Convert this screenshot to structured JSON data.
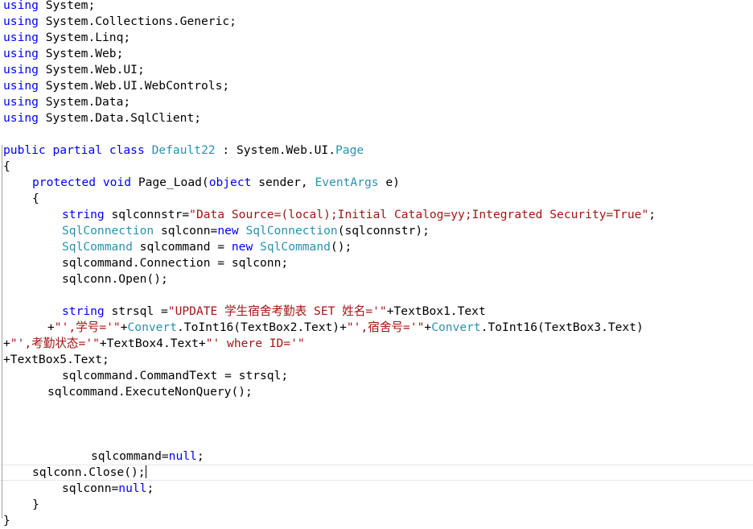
{
  "colors": {
    "keyword": "#0000ff",
    "type": "#2b91af",
    "string": "#a31515",
    "text": "#000000"
  },
  "code": {
    "usings": [
      {
        "kw": "using",
        "ns": " System;"
      },
      {
        "kw": "using",
        "ns": " System.Collections.Generic;"
      },
      {
        "kw": "using",
        "ns": " System.Linq;"
      },
      {
        "kw": "using",
        "ns": " System.Web;"
      },
      {
        "kw": "using",
        "ns": " System.Web.UI;"
      },
      {
        "kw": "using",
        "ns": " System.Web.UI.WebControls;"
      },
      {
        "kw": "using",
        "ns": " System.Data;"
      },
      {
        "kw": "using",
        "ns": " System.Data.SqlClient;"
      }
    ],
    "class_decl": {
      "kw1": "public",
      "kw2": "partial",
      "kw3": "class",
      "name": "Default22",
      "sep": " : System.Web.UI.",
      "base": "Page"
    },
    "open_brace": "{",
    "method_decl": {
      "kw1": "protected",
      "kw2": "void",
      "name": " Page_Load(",
      "ptype1": "object",
      "p1": " sender, ",
      "ptype2": "EventArgs",
      "p2": " e)"
    },
    "method_open": "{",
    "connstr_line": {
      "kw": "string",
      "name": " sqlconnstr=",
      "value": "\"Data Source=(local);Initial Catalog=yy;Integrated Security=True\"",
      "end": ";"
    },
    "conn_line": {
      "type1": "SqlConnection",
      "mid": " sqlconn=",
      "kw": "new",
      "type2": "SqlConnection",
      "end": "(sqlconnstr);"
    },
    "cmd_line": {
      "type1": "SqlCommand",
      "mid": " sqlcommand = ",
      "kw": "new",
      "type2": "SqlCommand",
      "end": "();"
    },
    "connection_assign": "sqlcommand.Connection = sqlconn;",
    "open_call": "sqlconn.Open();",
    "strsql_line": {
      "kw": "string",
      "mid": " strsql =",
      "s1": "\"UPDATE 学生宿舍考勤表 SET 姓名='\"",
      "end": "+TextBox1.Text"
    },
    "strsql_cont1": {
      "plus": "+",
      "s1": "\"',学号='\"",
      "p1": "+",
      "conv1": "Convert",
      "call1": ".ToInt16(TextBox2.Text)+",
      "s2": "\"',宿舍号='\"",
      "p2": "+",
      "conv2": "Convert",
      "call2": ".ToInt16(TextBox3.Text)"
    },
    "strsql_cont2": {
      "plus": "+",
      "s1": "\"',考勤状态='\"",
      "mid": "+TextBox4.Text+",
      "s2": "\"' where ID='\""
    },
    "strsql_cont3": "+TextBox5.Text;",
    "commandtext_assign": "sqlcommand.CommandText = strsql;",
    "execute_call": "sqlcommand.ExecuteNonQuery();",
    "cmd_null": {
      "pre": "sqlcommand=",
      "kw": "null",
      "end": ";"
    },
    "close_call": "sqlconn.Close();",
    "conn_null": {
      "pre": "sqlconn=",
      "kw": "null",
      "end": ";"
    },
    "method_close": "}",
    "class_close": "}"
  }
}
